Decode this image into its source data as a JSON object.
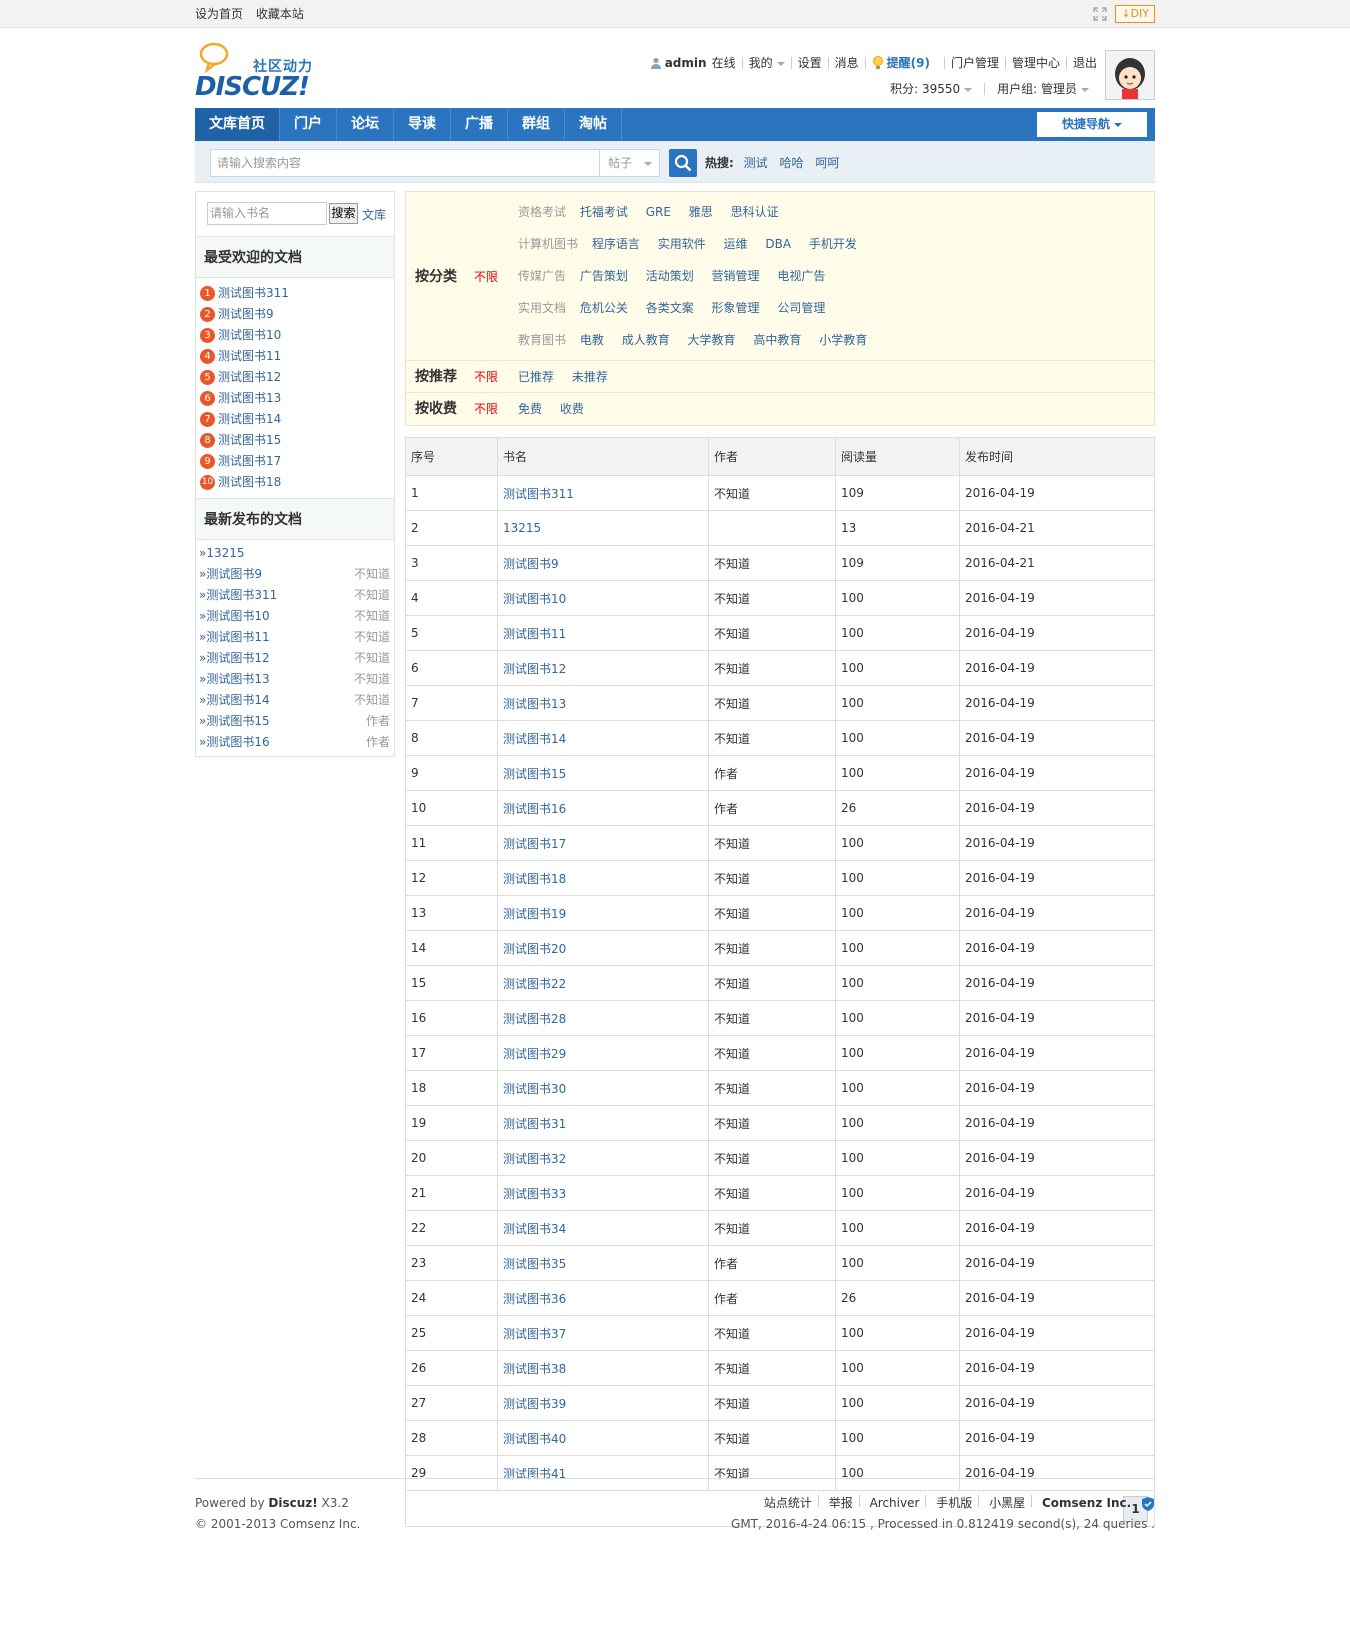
{
  "topbar": {
    "sethome": "设为首页",
    "favorite": "收藏本站",
    "diy": "DIY"
  },
  "logo": {
    "subtitle": "社区动力",
    "name": "DISCUZ!"
  },
  "user": {
    "name": "admin",
    "status": "在线",
    "mine": "我的",
    "settings": "设置",
    "messages": "消息",
    "remind": "提醒(9)",
    "portal_manage": "门户管理",
    "admin_center": "管理中心",
    "logout": "退出",
    "points": "积分: 39550",
    "usergroup": "用户组: 管理员"
  },
  "nav": {
    "items": [
      "文库首页",
      "门户",
      "论坛",
      "导读",
      "广播",
      "群组",
      "淘帖"
    ],
    "quick": "快捷导航"
  },
  "search": {
    "placeholder": "请输入搜索内容",
    "type": "帖子",
    "hot_label": "热搜:",
    "hot": [
      "测试",
      "哈哈",
      "呵呵"
    ]
  },
  "sidebar": {
    "search_placeholder": "请输入书名",
    "search_btn": "搜索",
    "wenku": "文库",
    "popular_title": "最受欢迎的文档",
    "popular": [
      "测试图书311",
      "测试图书9",
      "测试图书10",
      "测试图书11",
      "测试图书12",
      "测试图书13",
      "测试图书14",
      "测试图书15",
      "测试图书17",
      "测试图书18"
    ],
    "popular_nums": [
      "1",
      "2",
      "3",
      "4",
      "5",
      "6",
      "7",
      "8",
      "9",
      "10"
    ],
    "latest_title": "最新发布的文档",
    "latest": [
      {
        "title": "»13215",
        "author": ""
      },
      {
        "title": "»测试图书9",
        "author": "不知道"
      },
      {
        "title": "»测试图书311",
        "author": "不知道"
      },
      {
        "title": "»测试图书10",
        "author": "不知道"
      },
      {
        "title": "»测试图书11",
        "author": "不知道"
      },
      {
        "title": "»测试图书12",
        "author": "不知道"
      },
      {
        "title": "»测试图书13",
        "author": "不知道"
      },
      {
        "title": "»测试图书14",
        "author": "不知道"
      },
      {
        "title": "»测试图书15",
        "author": "作者"
      },
      {
        "title": "»测试图书16",
        "author": "作者"
      }
    ]
  },
  "filter": {
    "category_label": "按分类",
    "unlimited": "不限",
    "groups": [
      {
        "name": "资格考试",
        "items": [
          "托福考试",
          "GRE",
          "雅思",
          "思科认证"
        ]
      },
      {
        "name": "计算机图书",
        "items": [
          "程序语言",
          "实用软件",
          "运维",
          "DBA",
          "手机开发"
        ]
      },
      {
        "name": "传媒广告",
        "items": [
          "广告策划",
          "活动策划",
          "营销管理",
          "电视广告"
        ]
      },
      {
        "name": "实用文档",
        "items": [
          "危机公关",
          "各类文案",
          "形象管理",
          "公司管理"
        ]
      },
      {
        "name": "教育图书",
        "items": [
          "电教",
          "成人教育",
          "大学教育",
          "高中教育",
          "小学教育"
        ]
      }
    ],
    "recommend_label": "按推荐",
    "recommend": [
      "已推荐",
      "未推荐"
    ],
    "fee_label": "按收费",
    "fee": [
      "免费",
      "收费"
    ]
  },
  "table": {
    "headers": [
      "序号",
      "书名",
      "作者",
      "阅读量",
      "发布时间"
    ],
    "rows": [
      [
        "1",
        "测试图书311",
        "不知道",
        "109",
        "2016-04-19"
      ],
      [
        "2",
        "13215",
        "",
        "13",
        "2016-04-21"
      ],
      [
        "3",
        "测试图书9",
        "不知道",
        "109",
        "2016-04-21"
      ],
      [
        "4",
        "测试图书10",
        "不知道",
        "100",
        "2016-04-19"
      ],
      [
        "5",
        "测试图书11",
        "不知道",
        "100",
        "2016-04-19"
      ],
      [
        "6",
        "测试图书12",
        "不知道",
        "100",
        "2016-04-19"
      ],
      [
        "7",
        "测试图书13",
        "不知道",
        "100",
        "2016-04-19"
      ],
      [
        "8",
        "测试图书14",
        "不知道",
        "100",
        "2016-04-19"
      ],
      [
        "9",
        "测试图书15",
        "作者",
        "100",
        "2016-04-19"
      ],
      [
        "10",
        "测试图书16",
        "作者",
        "26",
        "2016-04-19"
      ],
      [
        "11",
        "测试图书17",
        "不知道",
        "100",
        "2016-04-19"
      ],
      [
        "12",
        "测试图书18",
        "不知道",
        "100",
        "2016-04-19"
      ],
      [
        "13",
        "测试图书19",
        "不知道",
        "100",
        "2016-04-19"
      ],
      [
        "14",
        "测试图书20",
        "不知道",
        "100",
        "2016-04-19"
      ],
      [
        "15",
        "测试图书22",
        "不知道",
        "100",
        "2016-04-19"
      ],
      [
        "16",
        "测试图书28",
        "不知道",
        "100",
        "2016-04-19"
      ],
      [
        "17",
        "测试图书29",
        "不知道",
        "100",
        "2016-04-19"
      ],
      [
        "18",
        "测试图书30",
        "不知道",
        "100",
        "2016-04-19"
      ],
      [
        "19",
        "测试图书31",
        "不知道",
        "100",
        "2016-04-19"
      ],
      [
        "20",
        "测试图书32",
        "不知道",
        "100",
        "2016-04-19"
      ],
      [
        "21",
        "测试图书33",
        "不知道",
        "100",
        "2016-04-19"
      ],
      [
        "22",
        "测试图书34",
        "不知道",
        "100",
        "2016-04-19"
      ],
      [
        "23",
        "测试图书35",
        "作者",
        "100",
        "2016-04-19"
      ],
      [
        "24",
        "测试图书36",
        "作者",
        "26",
        "2016-04-19"
      ],
      [
        "25",
        "测试图书37",
        "不知道",
        "100",
        "2016-04-19"
      ],
      [
        "26",
        "测试图书38",
        "不知道",
        "100",
        "2016-04-19"
      ],
      [
        "27",
        "测试图书39",
        "不知道",
        "100",
        "2016-04-19"
      ],
      [
        "28",
        "测试图书40",
        "不知道",
        "100",
        "2016-04-19"
      ],
      [
        "29",
        "测试图书41",
        "不知道",
        "100",
        "2016-04-19"
      ]
    ]
  },
  "pager": {
    "current": "1"
  },
  "footer": {
    "powered_prefix": "Powered by ",
    "powered_brand": "Discuz!",
    "powered_ver": " X3.2",
    "copyright": "© 2001-2013 Comsenz Inc.",
    "links": [
      "站点统计",
      "举报",
      "Archiver",
      "手机版",
      "小黑屋",
      "Comsenz Inc."
    ],
    "stats": "GMT, 2016-4-24 06:15 , Processed in 0.812419 second(s), 24 queries ."
  },
  "colors": {
    "nav": "#2b75c0",
    "link": "#336699",
    "accent_red": "#e00000",
    "rank_badge": "#e8562a"
  }
}
